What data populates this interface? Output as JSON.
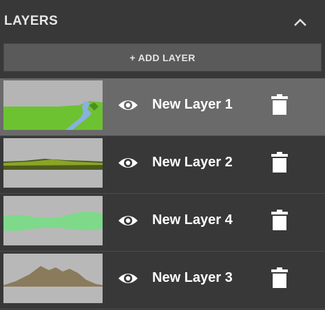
{
  "panel": {
    "title": "LAYERS",
    "collapse_icon": "chevron-up-icon"
  },
  "add_layer": {
    "label": "+ ADD LAYER"
  },
  "layers": [
    {
      "name": "New Layer 1",
      "selected": true,
      "thumbnail": "green field with blue river",
      "visibility_icon": "eye-icon",
      "delete_icon": "trash-icon"
    },
    {
      "name": "New Layer 2",
      "selected": false,
      "thumbnail": "olive horizontal band",
      "visibility_icon": "eye-icon",
      "delete_icon": "trash-icon"
    },
    {
      "name": "New Layer 4",
      "selected": false,
      "thumbnail": "light green wavy band",
      "visibility_icon": "eye-icon",
      "delete_icon": "trash-icon"
    },
    {
      "name": "New Layer 3",
      "selected": false,
      "thumbnail": "brown mountain silhouette",
      "visibility_icon": "eye-icon",
      "delete_icon": "trash-icon"
    }
  ],
  "colors": {
    "background": "#383838",
    "selected_row": "#6a6a6a",
    "button": "#5a5a5a",
    "text": "#ffffff"
  }
}
